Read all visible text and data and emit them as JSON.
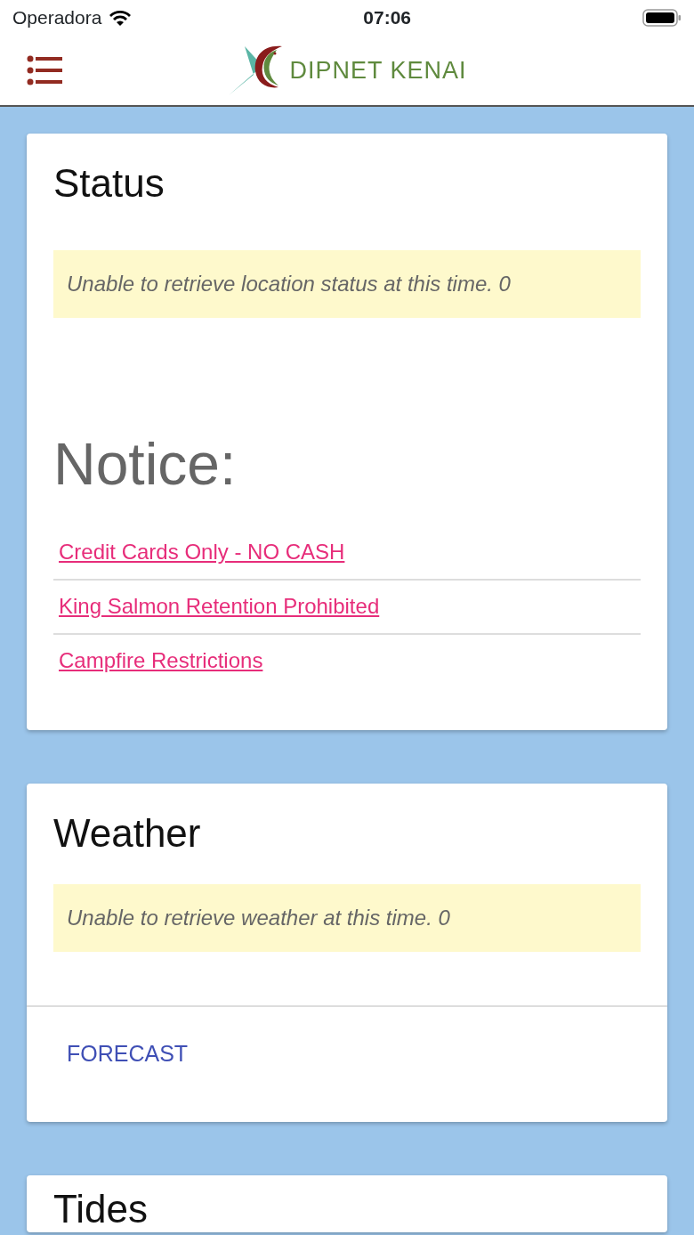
{
  "status_bar": {
    "carrier": "Operadora",
    "time": "07:06"
  },
  "header": {
    "brand": "DIPNET KENAI"
  },
  "status_card": {
    "title": "Status",
    "message": "Unable to retrieve location status at this time. 0",
    "notice_title": "Notice:",
    "notices": [
      {
        "label": "Credit Cards Only - NO CASH"
      },
      {
        "label": "King Salmon Retention Prohibited"
      },
      {
        "label": "Campfire Restrictions"
      }
    ]
  },
  "weather_card": {
    "title": "Weather",
    "message": "Unable to retrieve weather at this time. 0",
    "button": "FORECAST"
  },
  "tides_card": {
    "title": "Tides"
  }
}
